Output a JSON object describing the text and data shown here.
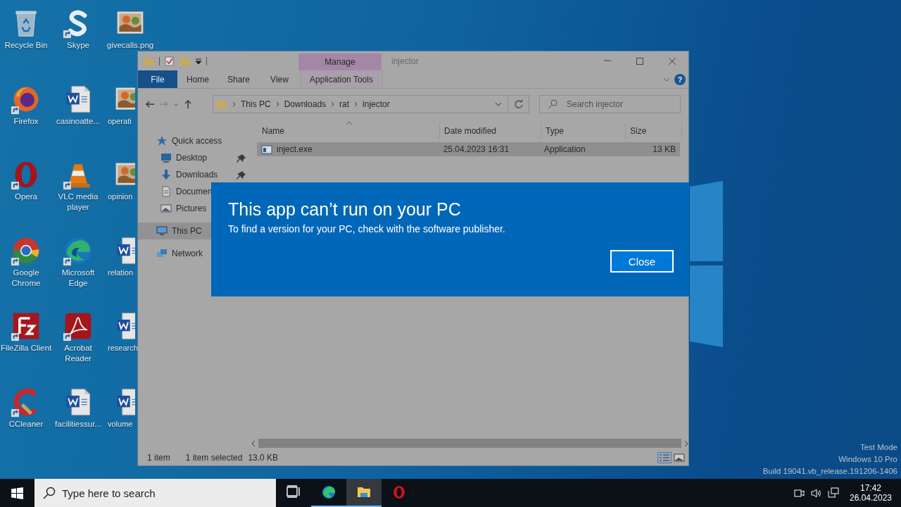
{
  "desktop_icons": [
    {
      "label": "Recycle Bin",
      "kind": "recycle",
      "shortcut": false
    },
    {
      "label": "Firefox",
      "kind": "firefox",
      "shortcut": true
    },
    {
      "label": "Opera",
      "kind": "opera",
      "shortcut": true
    },
    {
      "label": "Google Chrome",
      "kind": "chrome",
      "shortcut": true
    },
    {
      "label": "FileZilla Client",
      "kind": "filezilla",
      "shortcut": true
    },
    {
      "label": "CCleaner",
      "kind": "ccleaner",
      "shortcut": true
    },
    {
      "label": "Skype",
      "kind": "skype",
      "shortcut": true
    },
    {
      "label": "casinoatte...",
      "kind": "word",
      "shortcut": false
    },
    {
      "label": "VLC media player",
      "kind": "vlc",
      "shortcut": true
    },
    {
      "label": "Microsoft Edge",
      "kind": "edge",
      "shortcut": true
    },
    {
      "label": "Acrobat Reader",
      "kind": "acrobat",
      "shortcut": true
    },
    {
      "label": "facilitiessur...",
      "kind": "word",
      "shortcut": false
    },
    {
      "label": "givecalls.png",
      "kind": "image",
      "shortcut": false
    },
    {
      "label": "operati",
      "kind": "image",
      "shortcut": false
    },
    {
      "label": "opinion",
      "kind": "image",
      "shortcut": false
    },
    {
      "label": "relation",
      "kind": "word",
      "shortcut": false
    },
    {
      "label": "research",
      "kind": "word",
      "shortcut": false
    },
    {
      "label": "volume",
      "kind": "word",
      "shortcut": false
    }
  ],
  "explorer": {
    "title": "injector",
    "context_tab": "Manage",
    "ribbon_tabs": [
      {
        "label": "File",
        "kind": "file"
      },
      {
        "label": "Home",
        "kind": "plain"
      },
      {
        "label": "Share",
        "kind": "plain"
      },
      {
        "label": "View",
        "kind": "plain"
      },
      {
        "label": "Application Tools",
        "kind": "contextual"
      }
    ],
    "help": "?",
    "address": [
      "This PC",
      "Downloads",
      "rat",
      "injector"
    ],
    "search": {
      "placeholder": "Search injector"
    },
    "nav": [
      {
        "label": "Quick access",
        "kind": "star",
        "selected": false,
        "children": [
          {
            "label": "Desktop",
            "kind": "desktop",
            "pinned": true
          },
          {
            "label": "Downloads",
            "kind": "download",
            "pinned": true
          },
          {
            "label": "Documen",
            "kind": "document",
            "pinned": false
          },
          {
            "label": "Pictures",
            "kind": "pictures",
            "pinned": false
          }
        ]
      },
      {
        "label": "This PC",
        "kind": "pc",
        "selected": true
      },
      {
        "label": "Network",
        "kind": "network",
        "selected": false
      }
    ],
    "columns": [
      "Name",
      "Date modified",
      "Type",
      "Size"
    ],
    "rows": [
      {
        "name": "inject.exe",
        "date": "25.04.2023 16:31",
        "type": "Application",
        "size": "13 KB",
        "selected": true
      }
    ],
    "status_bar": {
      "count": "1 item",
      "selection": "1 item selected",
      "size": "13.0 KB"
    }
  },
  "dialog": {
    "title": "This app can’t run on your PC",
    "message": "To find a version for your PC, check with the software publisher.",
    "button": "Close"
  },
  "system_info": [
    "Test Mode",
    "Windows 10 Pro",
    "Build 19041.vb_release.191206-1406"
  ],
  "taskbar": {
    "search": {
      "placeholder": "Type here to search"
    },
    "apps": [
      {
        "kind": "taskview",
        "running": false,
        "selected": false
      },
      {
        "kind": "edge",
        "running": true,
        "selected": false
      },
      {
        "kind": "folder",
        "running": true,
        "selected": true
      },
      {
        "kind": "opera",
        "running": false,
        "selected": false
      }
    ],
    "time": "17:42",
    "date": "26.04.2023"
  }
}
